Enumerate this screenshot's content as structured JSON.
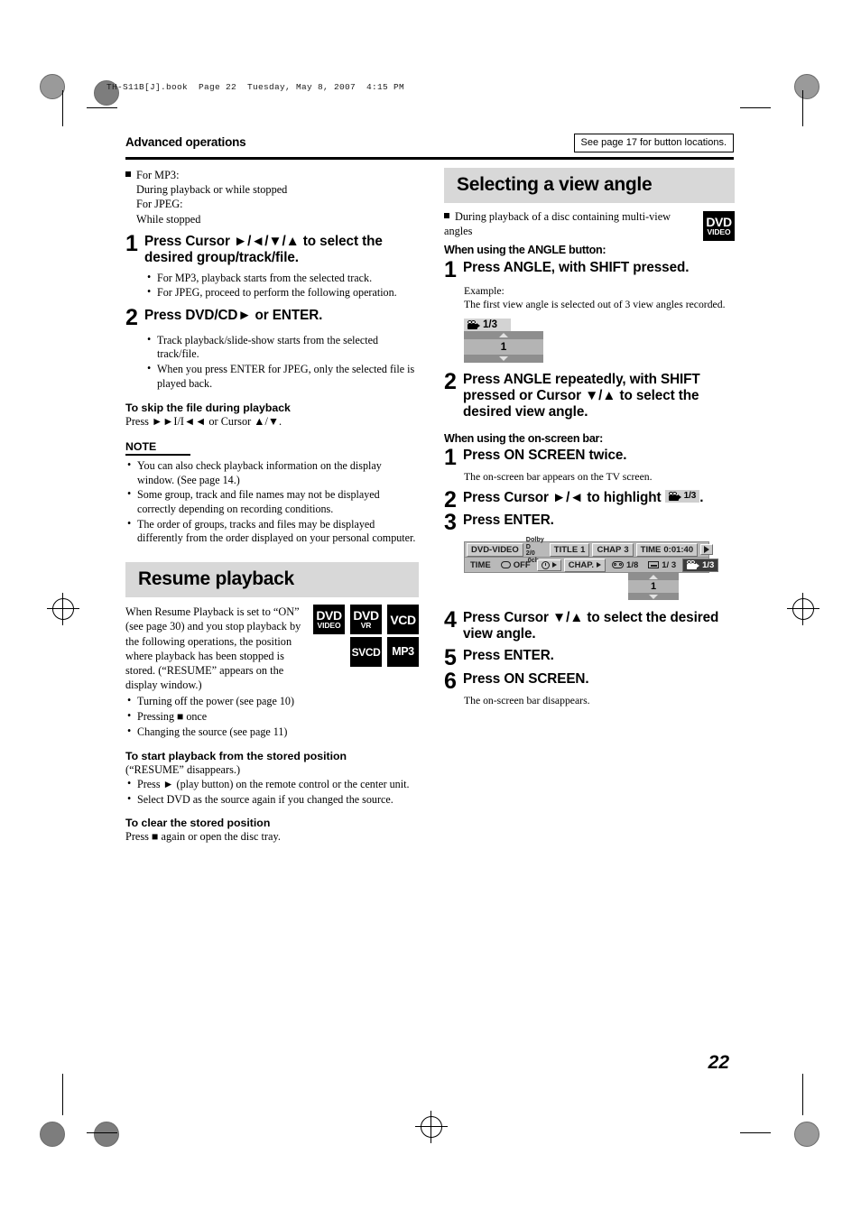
{
  "file_header": "TH-S11B[J].book  Page 22  Tuesday, May 8, 2007  4:15 PM",
  "running_head": "Advanced operations",
  "see_page_note": "See page 17 for button locations.",
  "page_number": "22",
  "left_column": {
    "intro": {
      "lines": [
        "For MP3:",
        "During playback or while stopped",
        "For JPEG:",
        "While stopped"
      ]
    },
    "steps": [
      {
        "num": "1",
        "text": "Press Cursor ►/◄/▼/▲ to select the desired group/track/file.",
        "bullets": [
          "For MP3, playback starts from the selected track.",
          "For JPEG, proceed to perform the following operation."
        ]
      },
      {
        "num": "2",
        "text": "Press DVD/CD► or ENTER.",
        "bullets": [
          "Track playback/slide-show starts from the selected track/file.",
          "When you press ENTER for JPEG, only the selected file is played back."
        ]
      }
    ],
    "skip_heading": "To skip the file during playback",
    "skip_text": "Press ►►I/I◄◄ or Cursor ▲/▼.",
    "note_heading": "NOTE",
    "notes": [
      "You can also check playback information on the display window. (See page 14.)",
      "Some group, track and file names may not be displayed correctly depending on recording conditions.",
      "The order of groups, tracks and files may be displayed differently from the order displayed on your personal computer."
    ],
    "resume": {
      "title": "Resume playback",
      "body": "When Resume Playback is set to “ON” (see page 30) and you stop playback by the following operations, the position where playback has been stopped is stored. (“RESUME” appears on the display window.)",
      "badges_row1": [
        {
          "line1": "DVD",
          "line2": "VIDEO"
        },
        {
          "line1": "DVD",
          "line2": "VR"
        },
        {
          "line1": "VCD",
          "line2": ""
        }
      ],
      "badges_row2": [
        {
          "line1": "SVCD",
          "line2": ""
        },
        {
          "line1": "MP3",
          "line2": ""
        }
      ],
      "conditions": [
        "Turning off the power (see page 10)",
        "Pressing ■ once",
        "Changing the source (see page 11)"
      ],
      "start_heading": "To start playback from the stored position",
      "start_note": "(“RESUME” disappears.)",
      "start_bullets": [
        "Press ► (play button) on the remote control or the center unit.",
        "Select DVD as the source again if you changed the source."
      ],
      "clear_heading": "To clear the stored position",
      "clear_text": "Press ■ again or open the disc tray."
    }
  },
  "right_column": {
    "title": "Selecting a view angle",
    "condition": "During playback of a disc containing multi-view angles",
    "badge": {
      "line1": "DVD",
      "line2": "VIDEO"
    },
    "angle_button_section": {
      "heading": "When using the ANGLE button:",
      "steps": [
        {
          "num": "1",
          "text": "Press ANGLE, with SHIFT pressed.",
          "notes": [
            "Example:",
            "The first view angle is selected out of 3 view angles recorded."
          ]
        },
        {
          "num": "2",
          "text": "Press ANGLE repeatedly, with SHIFT pressed or Cursor ▼/▲ to select the desired view angle."
        }
      ],
      "popup": {
        "label": "1/3",
        "value": "1"
      }
    },
    "onscreen_section": {
      "heading": "When using the on-screen bar:",
      "steps": [
        {
          "num": "1",
          "text": "Press ON SCREEN twice.",
          "note": "The on-screen bar appears on the TV screen."
        },
        {
          "num": "2",
          "text_before": "Press Cursor ►/◄ to highlight",
          "inline_badge": "1/3",
          "text_after": "."
        },
        {
          "num": "3",
          "text": "Press ENTER."
        },
        {
          "num": "4",
          "text": "Press Cursor ▼/▲ to select the desired view angle."
        },
        {
          "num": "5",
          "text": "Press ENTER."
        },
        {
          "num": "6",
          "text": "Press ON SCREEN.",
          "note": "The on-screen bar disappears."
        }
      ]
    },
    "onscreen_bar": {
      "disc_type": "DVD-VIDEO",
      "audio_format_line1": "Dolby D",
      "audio_format_line2": "2/0 .0ch",
      "title_label": "TITLE",
      "title_value": "1",
      "chapter_label": "CHAP",
      "chapter_value": "3",
      "time_label": "TIME",
      "time_value": "0:01:40",
      "row2": {
        "time_label": "TIME",
        "repeat_value": "OFF",
        "chapter_label": "CHAP.",
        "audio_value": "1/8",
        "subtitle_value": "1/ 3",
        "angle_value": "1/3"
      },
      "dropdown_value": "1"
    }
  },
  "colors": {
    "banner_bg": "#d8d8d8",
    "badge_bg": "#000000",
    "osb_bg": "#b9b9b9",
    "osb_cell": "#c9c9c9",
    "osb_selected": "#3b3b3b"
  }
}
